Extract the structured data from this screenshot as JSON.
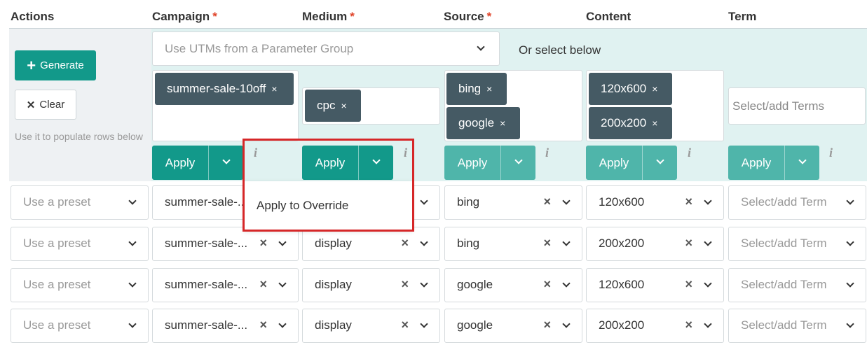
{
  "headers": {
    "actions": "Actions",
    "campaign": "Campaign",
    "medium": "Medium",
    "source": "Source",
    "content": "Content",
    "term": "Term",
    "required_mark": "*"
  },
  "actions": {
    "generate_label": "Generate",
    "clear_label": "Clear",
    "hint": "Use it to populate rows below"
  },
  "parameter_group": {
    "placeholder": "Use UTMs from a Parameter Group",
    "or_select": "Or select below"
  },
  "tags": {
    "campaign": [
      "summer-sale-10off"
    ],
    "medium": [
      "cpc"
    ],
    "source": [
      "bing",
      "google"
    ],
    "content": [
      "120x600",
      "200x200"
    ]
  },
  "term_input_placeholder": "Select/add Terms",
  "apply_label": "Apply",
  "info_label": "i",
  "tag_remove": "×",
  "dropdown_menu": {
    "item": "Apply to Override"
  },
  "rows": [
    {
      "preset": "Use a preset",
      "campaign": "summer-sale-...",
      "medium": "display",
      "source": "bing",
      "content": "120x600",
      "term": "Select/add Term"
    },
    {
      "preset": "Use a preset",
      "campaign": "summer-sale-...",
      "medium": "display",
      "source": "bing",
      "content": "200x200",
      "term": "Select/add Term"
    },
    {
      "preset": "Use a preset",
      "campaign": "summer-sale-...",
      "medium": "display",
      "source": "google",
      "content": "120x600",
      "term": "Select/add Term"
    },
    {
      "preset": "Use a preset",
      "campaign": "summer-sale-...",
      "medium": "display",
      "source": "google",
      "content": "200x200",
      "term": "Select/add Term"
    }
  ],
  "colors": {
    "primary": "#12998a",
    "primary_light": "#4fb5aa",
    "tag_bg": "#455a64",
    "band_bg": "#e0f2f1",
    "highlight": "#d62728"
  }
}
